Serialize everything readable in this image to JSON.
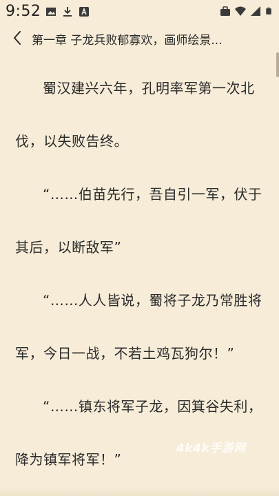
{
  "status_bar": {
    "time": "9:52",
    "left_icons": [
      "image-icon",
      "download-icon",
      "font-icon"
    ],
    "right_icons": [
      "briefcase-icon",
      "wifi-icon",
      "signal-icon",
      "battery-icon"
    ]
  },
  "header": {
    "back_icon": "chevron-left-icon",
    "title": "第一章 子龙兵败郁寡欢，画师绘景..."
  },
  "content": {
    "paragraphs": [
      "蜀汉建兴六年，孔明率军第一次北伐，以失败告终。",
      "“……伯苗先行，吾自引一军，伏于其后，以断敌军”",
      "“……人人皆说，蜀将子龙乃常胜将军，今日一战，不若土鸡瓦狗尔！”",
      "“……镇东将军子龙，因箕谷失利，降为镇军将军！”"
    ]
  },
  "watermark": "4k4k手游网",
  "colors": {
    "background": "#f6ecd8",
    "text": "#2b2b2b"
  }
}
